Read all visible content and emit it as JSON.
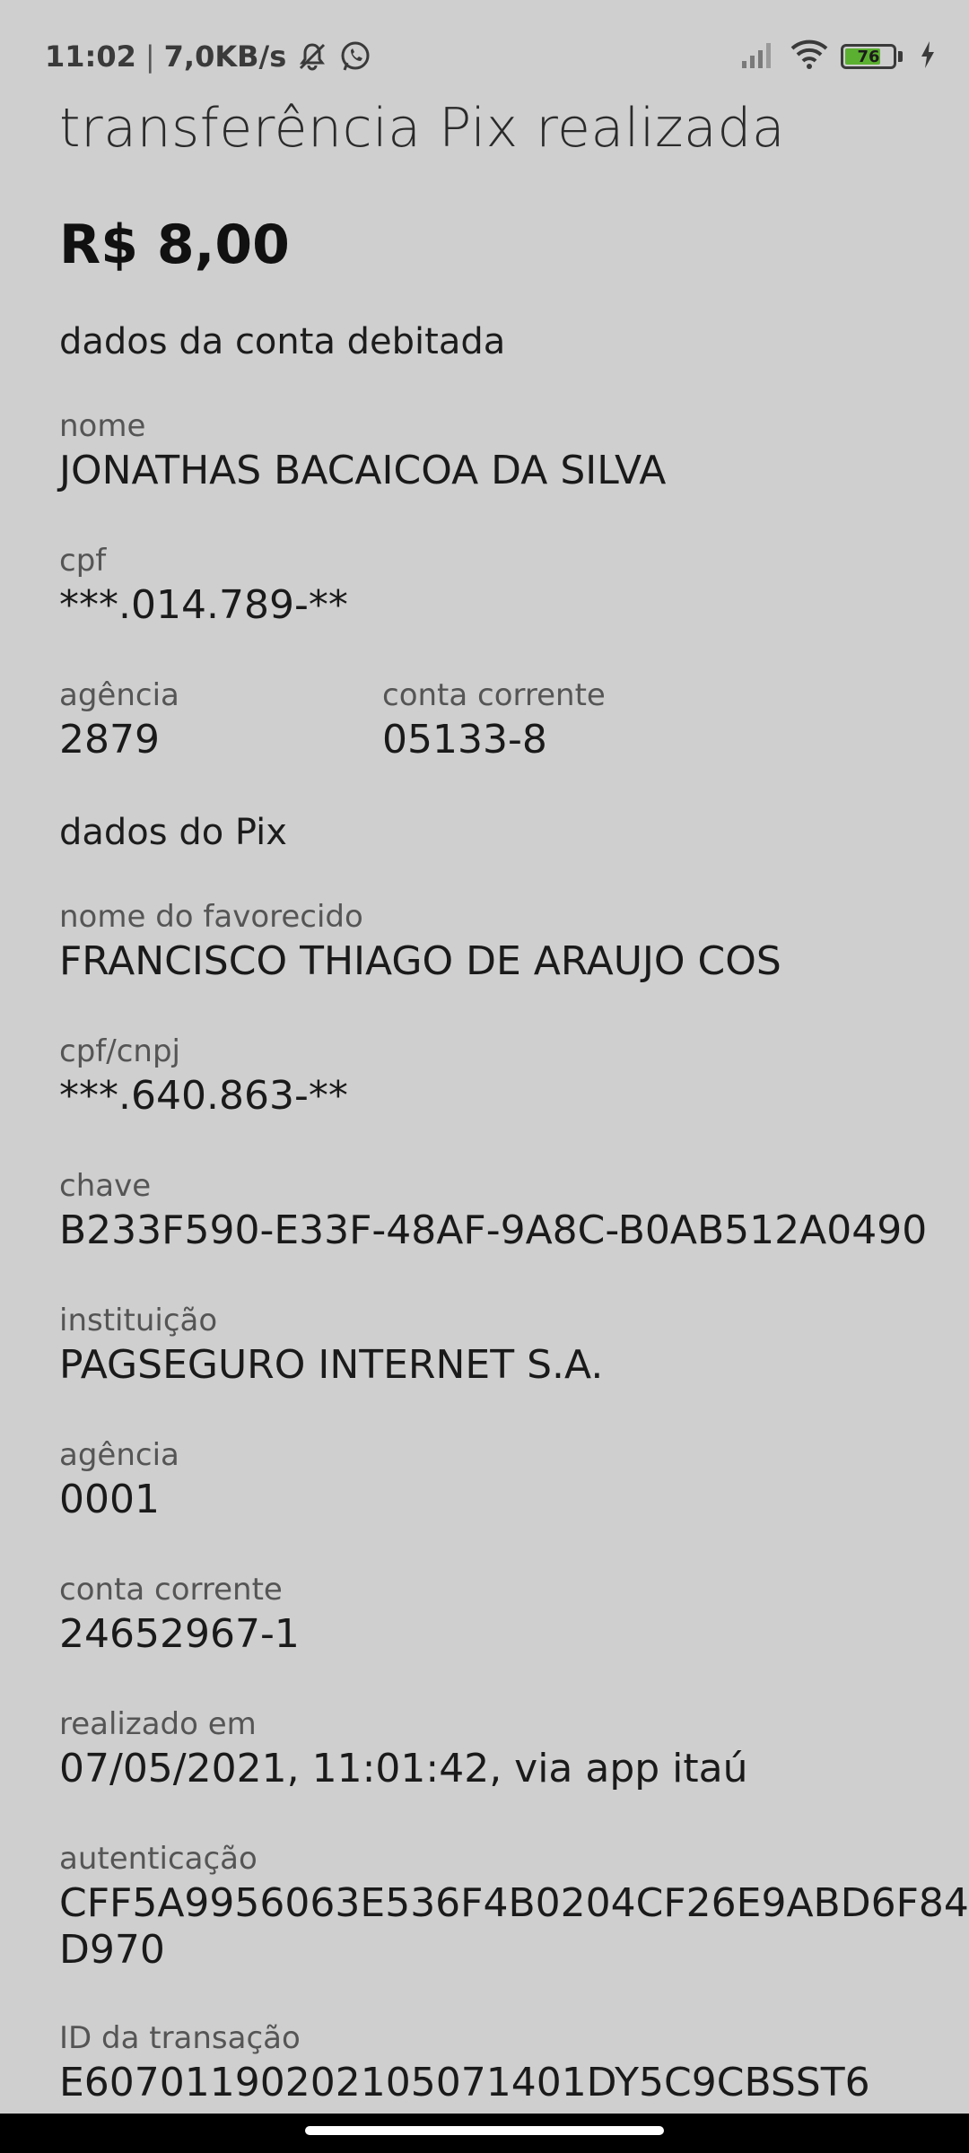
{
  "status_bar": {
    "time": "11:02",
    "net_speed": "7,0KB/s",
    "battery_level": "76",
    "battery_fraction": 0.76,
    "icons": [
      "mute-icon",
      "whatsapp-icon",
      "signal-icon",
      "wifi-icon",
      "battery-icon",
      "charging-icon"
    ]
  },
  "header": {
    "title": "transferência Pix realizada",
    "amount": "R$ 8,00"
  },
  "debit_account": {
    "section_title": "dados da conta debitada",
    "name_label": "nome",
    "name_value": "JONATHAS BACAICOA DA SILVA",
    "cpf_label": "cpf",
    "cpf_value": "***.014.789-**",
    "agency_label": "agência",
    "agency_value": "2879",
    "account_label": "conta corrente",
    "account_value": "05133-8"
  },
  "pix": {
    "section_title": "dados do Pix",
    "payee_label": "nome do favorecido",
    "payee_value": "FRANCISCO THIAGO DE ARAUJO COS",
    "doc_label": "cpf/cnpj",
    "doc_value": "***.640.863-**",
    "key_label": "chave",
    "key_value": "B233F590-E33F-48AF-9A8C-B0AB512A0490",
    "institution_label": "instituição",
    "institution_value": "PAGSEGURO INTERNET S.A.",
    "agency_label": "agência",
    "agency_value": "0001",
    "account_label": "conta corrente",
    "account_value": "24652967-1",
    "date_label": "realizado em",
    "date_value": "07/05/2021, 11:01:42, via app itaú",
    "auth_label": "autenticação",
    "auth_value": "CFF5A9956063E536F4B0204CF26E9ABD6F84\nD970",
    "txid_label": "ID da transação",
    "txid_value": "E60701190202105071401DY5C9CBSST6"
  },
  "colors": {
    "background": "#cfcfcf",
    "text": "#1a1a1a",
    "label": "#555555",
    "battery": "#5cb031",
    "nav_bar": "#000000"
  }
}
